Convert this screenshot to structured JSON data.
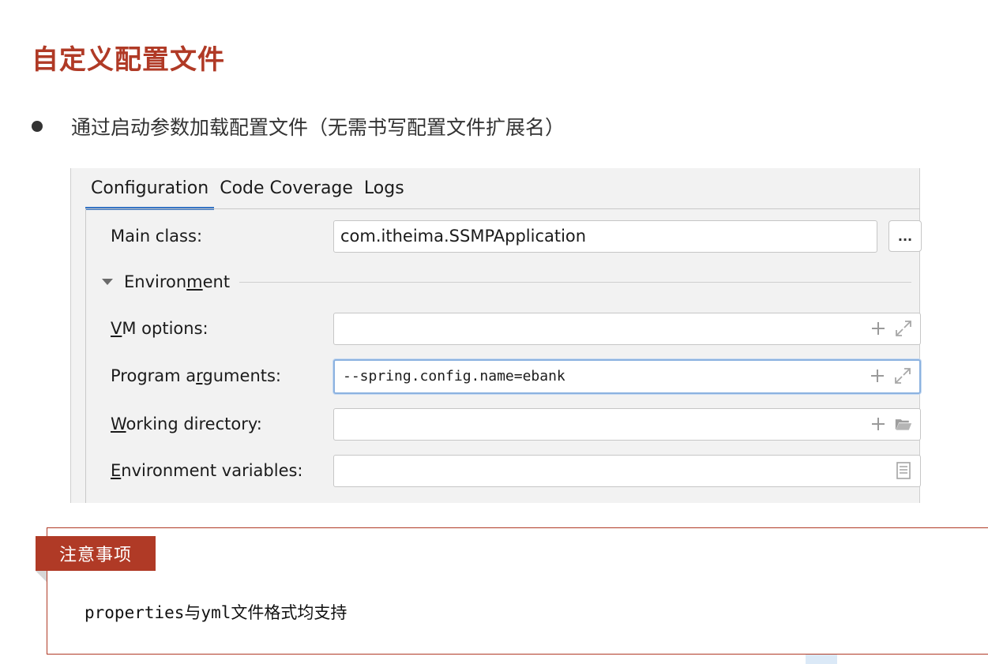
{
  "slide": {
    "title": "自定义配置文件",
    "bullet": "通过启动参数加载配置文件（无需书写配置文件扩展名）"
  },
  "ide": {
    "tabs": [
      {
        "label": "Configuration",
        "active": true
      },
      {
        "label": "Code Coverage",
        "active": false
      },
      {
        "label": "Logs",
        "active": false
      }
    ],
    "main_class": {
      "label": "Main class:",
      "value": "com.itheima.SSMPApplication",
      "browse_label": "..."
    },
    "environment": {
      "pre": "Environ",
      "mnemonic": "m",
      "post": "ent",
      "expanded": true
    },
    "vm_options": {
      "mnemonic": "V",
      "label_rest": "M options:",
      "value": ""
    },
    "program_arguments": {
      "pre": "Program a",
      "mnemonic": "r",
      "post": "guments:",
      "value": "--spring.config.name=ebank"
    },
    "working_directory": {
      "mnemonic": "W",
      "label_rest": "orking directory:",
      "value": ""
    },
    "environment_variables": {
      "mnemonic": "E",
      "label_rest": "nvironment variables:",
      "value": ""
    },
    "icons": {
      "add": "plus-icon",
      "expand": "expand-icon",
      "folder": "folder-icon",
      "document": "document-icon"
    },
    "colors": {
      "tab_underline": "#3574c4",
      "focus_border": "#8cb2e0"
    }
  },
  "note": {
    "tag": "注意事项",
    "text": "properties与yml文件格式均支持"
  },
  "colors": {
    "accent": "#b03a26"
  }
}
